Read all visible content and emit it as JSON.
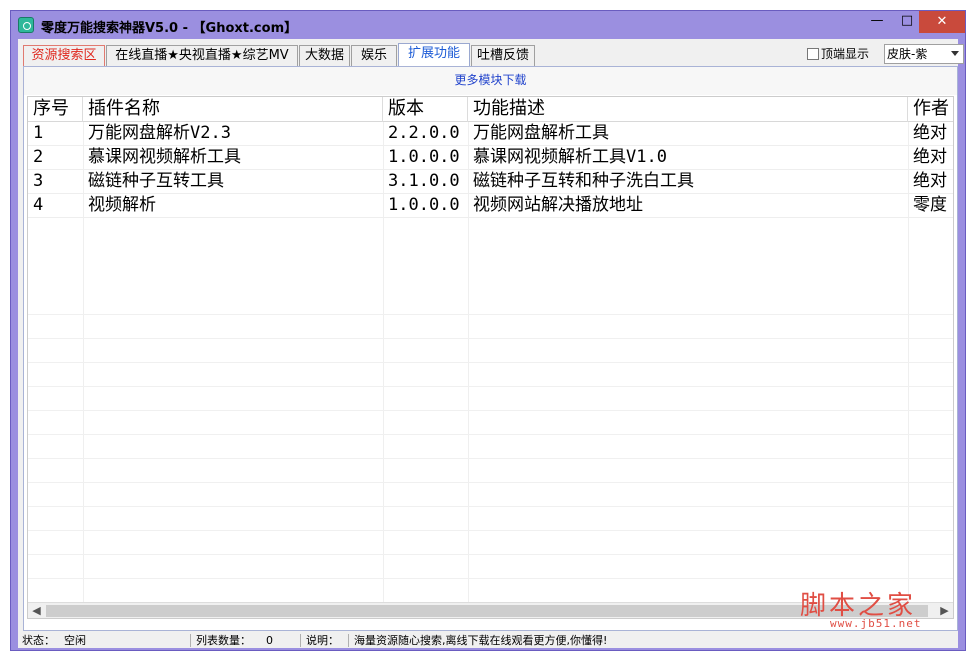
{
  "window": {
    "title": "零度万能搜索神器V5.0 - 【Ghoxt.com】",
    "controls": {
      "minimize": "—",
      "maximize": "□",
      "close": "✕"
    }
  },
  "tabs": [
    {
      "label": "资源搜索区"
    },
    {
      "label": "在线直播★央视直播★综艺MV"
    },
    {
      "label": "大数据"
    },
    {
      "label": "娱乐"
    },
    {
      "label": "扩展功能"
    },
    {
      "label": "吐槽反馈"
    }
  ],
  "active_tab": "扩展功能",
  "options": {
    "topmost_label": "顶端显示",
    "topmost_checked": false,
    "skin_value": "皮肤-紫"
  },
  "panel": {
    "more_modules_link": "更多模块下载"
  },
  "plugin_table": {
    "columns": [
      "序号",
      "插件名称",
      "版本",
      "功能描述",
      "作者"
    ],
    "rows": [
      [
        "1",
        "万能网盘解析V2.3",
        "2.2.0.0",
        "万能网盘解析工具",
        "绝对"
      ],
      [
        "2",
        "慕课网视频解析工具",
        "1.0.0.0",
        "慕课网视频解析工具V1.0",
        "绝对"
      ],
      [
        "3",
        "磁链种子互转工具",
        "3.1.0.0",
        "磁链种子互转和种子洗白工具",
        "绝对"
      ],
      [
        "4",
        "视频解析",
        "1.0.0.0",
        "视频网站解决播放地址",
        "零度"
      ]
    ]
  },
  "watermark": {
    "text": "脚本之家",
    "url": "www.jb51.net"
  },
  "statusbar": {
    "status_label": "状态：",
    "status_value": "空闲",
    "count_label": "列表数量：",
    "count_value": "0",
    "desc_label": "说明：",
    "desc_value": "海量资源随心搜索,离线下载在线观看更方便,你懂得!"
  },
  "colors": {
    "window_frame": "#9b8fe0",
    "close_button": "#c94a3c",
    "active_tab_text": "#1c5bd6",
    "first_tab_text": "#e0281e",
    "link": "#2244cc",
    "watermark": "#e04e44"
  }
}
